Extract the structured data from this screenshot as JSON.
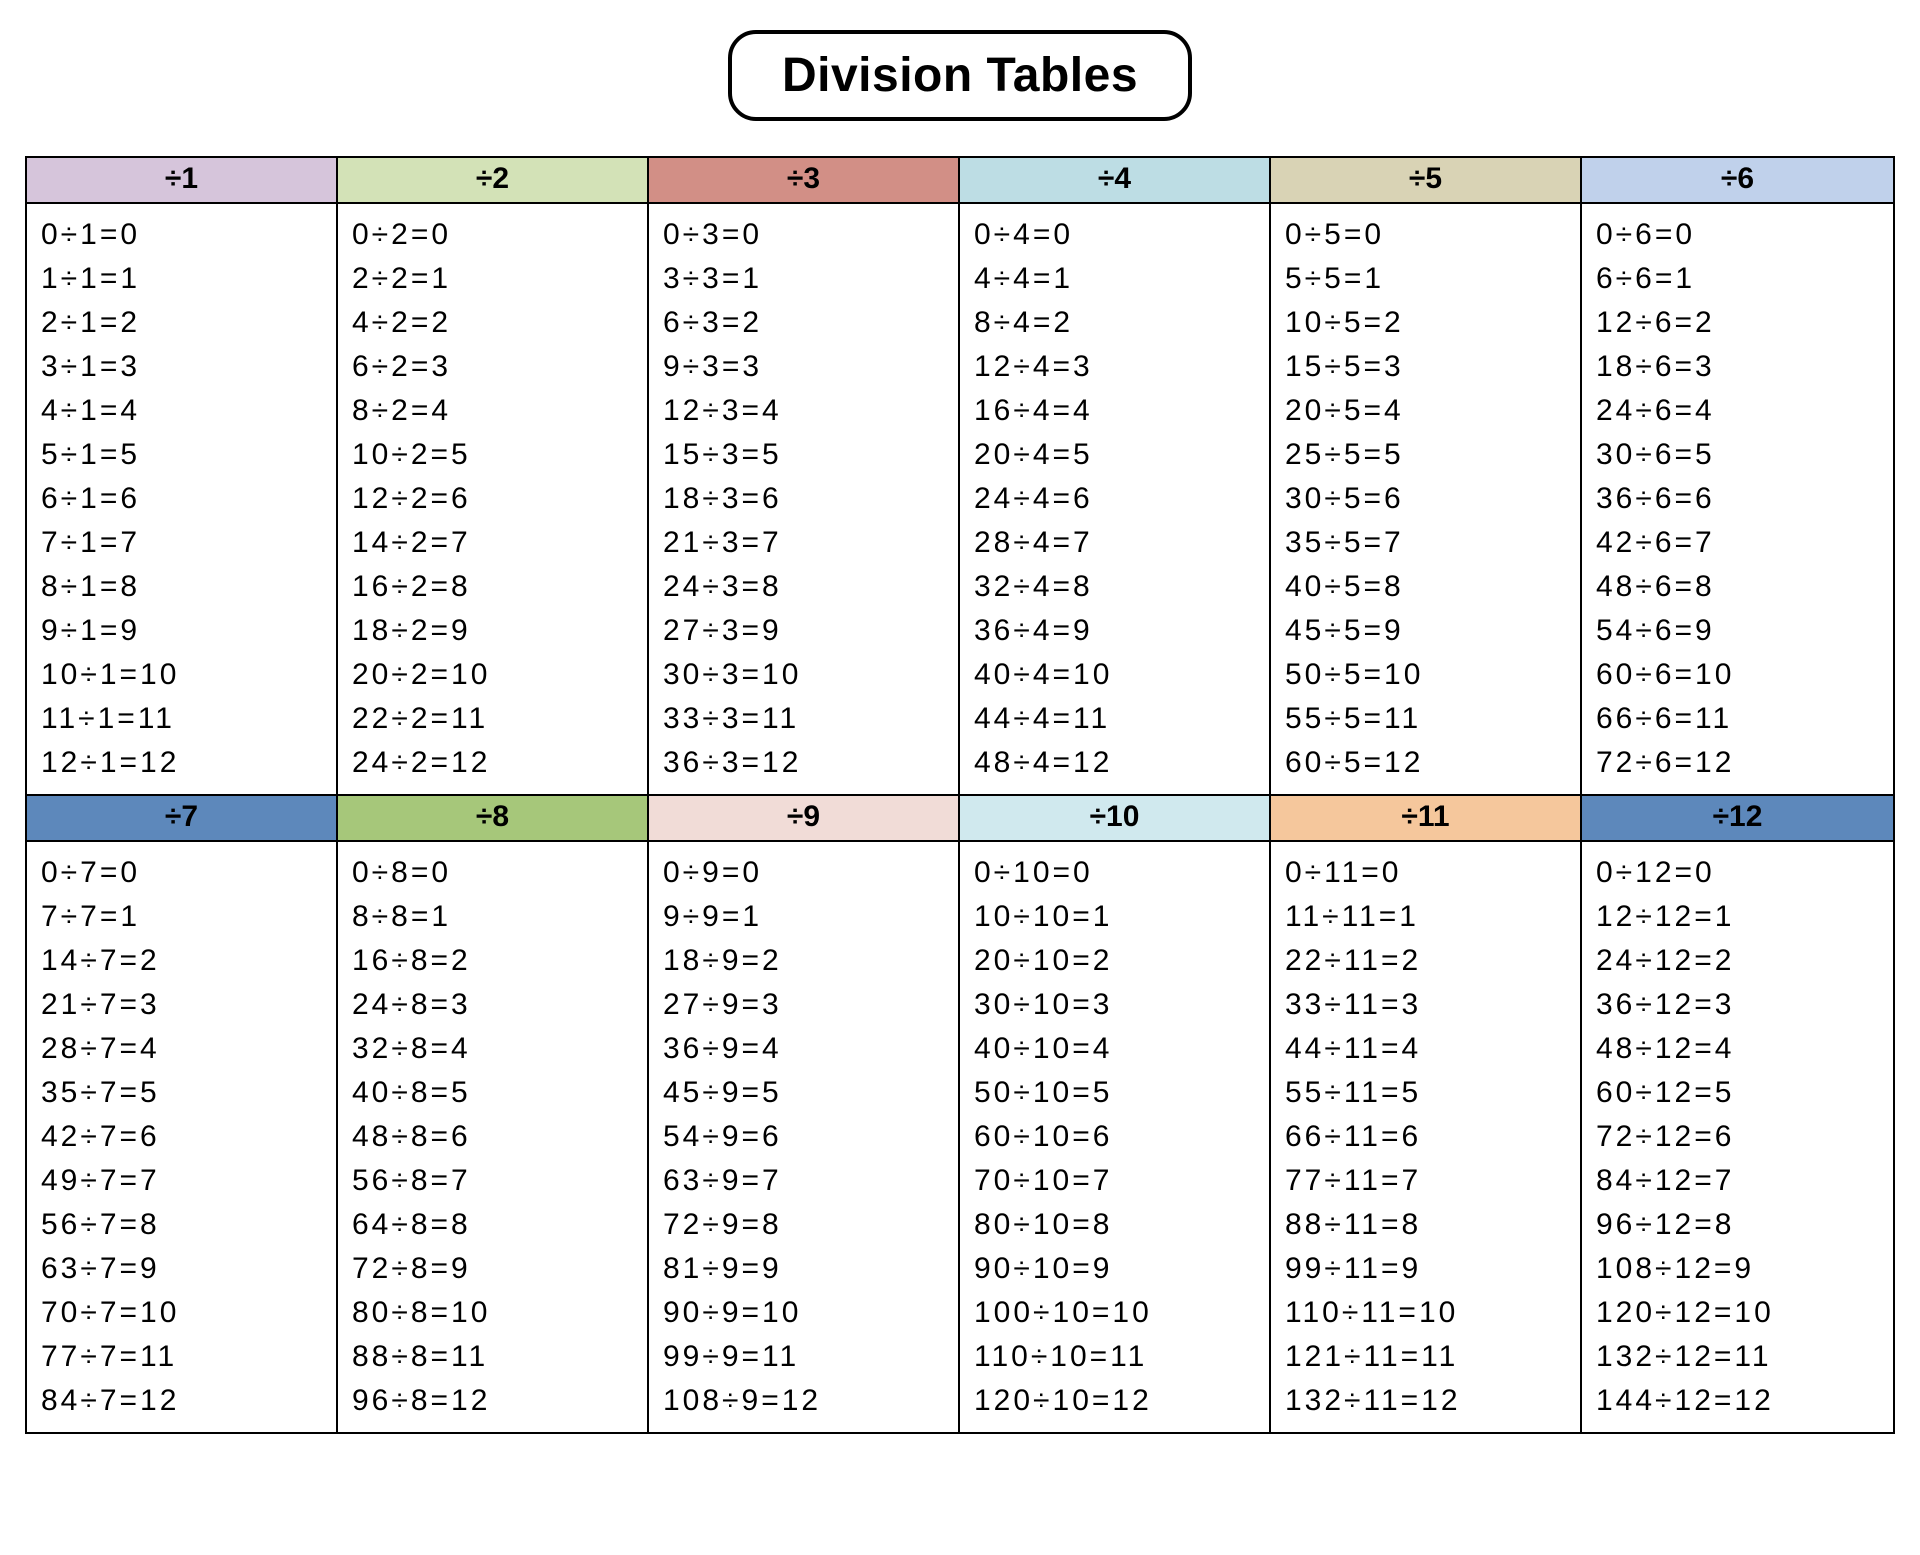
{
  "title": "Division Tables",
  "headerColors": {
    "1": "#d6c5db",
    "2": "#d3e2b7",
    "3": "#d28f86",
    "4": "#bddde4",
    "5": "#d9d3b5",
    "6": "#c0d1eb",
    "7": "#5d88bb",
    "8": "#a6c77a",
    "9": "#f1dcd7",
    "10": "#d0e9ee",
    "11": "#f5c79c",
    "12": "#5d88bb"
  },
  "chart_data": {
    "type": "table",
    "title": "Division Tables",
    "divisors": [
      1,
      2,
      3,
      4,
      5,
      6,
      7,
      8,
      9,
      10,
      11,
      12
    ],
    "quotients": [
      0,
      1,
      2,
      3,
      4,
      5,
      6,
      7,
      8,
      9,
      10,
      11,
      12
    ],
    "tables": [
      {
        "divisor": 1,
        "header": "÷1",
        "rows": [
          [
            0,
            1,
            0
          ],
          [
            1,
            1,
            1
          ],
          [
            2,
            1,
            2
          ],
          [
            3,
            1,
            3
          ],
          [
            4,
            1,
            4
          ],
          [
            5,
            1,
            5
          ],
          [
            6,
            1,
            6
          ],
          [
            7,
            1,
            7
          ],
          [
            8,
            1,
            8
          ],
          [
            9,
            1,
            9
          ],
          [
            10,
            1,
            10
          ],
          [
            11,
            1,
            11
          ],
          [
            12,
            1,
            12
          ]
        ]
      },
      {
        "divisor": 2,
        "header": "÷2",
        "rows": [
          [
            0,
            2,
            0
          ],
          [
            2,
            2,
            1
          ],
          [
            4,
            2,
            2
          ],
          [
            6,
            2,
            3
          ],
          [
            8,
            2,
            4
          ],
          [
            10,
            2,
            5
          ],
          [
            12,
            2,
            6
          ],
          [
            14,
            2,
            7
          ],
          [
            16,
            2,
            8
          ],
          [
            18,
            2,
            9
          ],
          [
            20,
            2,
            10
          ],
          [
            22,
            2,
            11
          ],
          [
            24,
            2,
            12
          ]
        ]
      },
      {
        "divisor": 3,
        "header": "÷3",
        "rows": [
          [
            0,
            3,
            0
          ],
          [
            3,
            3,
            1
          ],
          [
            6,
            3,
            2
          ],
          [
            9,
            3,
            3
          ],
          [
            12,
            3,
            4
          ],
          [
            15,
            3,
            5
          ],
          [
            18,
            3,
            6
          ],
          [
            21,
            3,
            7
          ],
          [
            24,
            3,
            8
          ],
          [
            27,
            3,
            9
          ],
          [
            30,
            3,
            10
          ],
          [
            33,
            3,
            11
          ],
          [
            36,
            3,
            12
          ]
        ]
      },
      {
        "divisor": 4,
        "header": "÷4",
        "rows": [
          [
            0,
            4,
            0
          ],
          [
            4,
            4,
            1
          ],
          [
            8,
            4,
            2
          ],
          [
            12,
            4,
            3
          ],
          [
            16,
            4,
            4
          ],
          [
            20,
            4,
            5
          ],
          [
            24,
            4,
            6
          ],
          [
            28,
            4,
            7
          ],
          [
            32,
            4,
            8
          ],
          [
            36,
            4,
            9
          ],
          [
            40,
            4,
            10
          ],
          [
            44,
            4,
            11
          ],
          [
            48,
            4,
            12
          ]
        ]
      },
      {
        "divisor": 5,
        "header": "÷5",
        "rows": [
          [
            0,
            5,
            0
          ],
          [
            5,
            5,
            1
          ],
          [
            10,
            5,
            2
          ],
          [
            15,
            5,
            3
          ],
          [
            20,
            5,
            4
          ],
          [
            25,
            5,
            5
          ],
          [
            30,
            5,
            6
          ],
          [
            35,
            5,
            7
          ],
          [
            40,
            5,
            8
          ],
          [
            45,
            5,
            9
          ],
          [
            50,
            5,
            10
          ],
          [
            55,
            5,
            11
          ],
          [
            60,
            5,
            12
          ]
        ]
      },
      {
        "divisor": 6,
        "header": "÷6",
        "rows": [
          [
            0,
            6,
            0
          ],
          [
            6,
            6,
            1
          ],
          [
            12,
            6,
            2
          ],
          [
            18,
            6,
            3
          ],
          [
            24,
            6,
            4
          ],
          [
            30,
            6,
            5
          ],
          [
            36,
            6,
            6
          ],
          [
            42,
            6,
            7
          ],
          [
            48,
            6,
            8
          ],
          [
            54,
            6,
            9
          ],
          [
            60,
            6,
            10
          ],
          [
            66,
            6,
            11
          ],
          [
            72,
            6,
            12
          ]
        ]
      },
      {
        "divisor": 7,
        "header": "÷7",
        "rows": [
          [
            0,
            7,
            0
          ],
          [
            7,
            7,
            1
          ],
          [
            14,
            7,
            2
          ],
          [
            21,
            7,
            3
          ],
          [
            28,
            7,
            4
          ],
          [
            35,
            7,
            5
          ],
          [
            42,
            7,
            6
          ],
          [
            49,
            7,
            7
          ],
          [
            56,
            7,
            8
          ],
          [
            63,
            7,
            9
          ],
          [
            70,
            7,
            10
          ],
          [
            77,
            7,
            11
          ],
          [
            84,
            7,
            12
          ]
        ]
      },
      {
        "divisor": 8,
        "header": "÷8",
        "rows": [
          [
            0,
            8,
            0
          ],
          [
            8,
            8,
            1
          ],
          [
            16,
            8,
            2
          ],
          [
            24,
            8,
            3
          ],
          [
            32,
            8,
            4
          ],
          [
            40,
            8,
            5
          ],
          [
            48,
            8,
            6
          ],
          [
            56,
            8,
            7
          ],
          [
            64,
            8,
            8
          ],
          [
            72,
            8,
            9
          ],
          [
            80,
            8,
            10
          ],
          [
            88,
            8,
            11
          ],
          [
            96,
            8,
            12
          ]
        ]
      },
      {
        "divisor": 9,
        "header": "÷9",
        "rows": [
          [
            0,
            9,
            0
          ],
          [
            9,
            9,
            1
          ],
          [
            18,
            9,
            2
          ],
          [
            27,
            9,
            3
          ],
          [
            36,
            9,
            4
          ],
          [
            45,
            9,
            5
          ],
          [
            54,
            9,
            6
          ],
          [
            63,
            9,
            7
          ],
          [
            72,
            9,
            8
          ],
          [
            81,
            9,
            9
          ],
          [
            90,
            9,
            10
          ],
          [
            99,
            9,
            11
          ],
          [
            108,
            9,
            12
          ]
        ]
      },
      {
        "divisor": 10,
        "header": "÷10",
        "rows": [
          [
            0,
            10,
            0
          ],
          [
            10,
            10,
            1
          ],
          [
            20,
            10,
            2
          ],
          [
            30,
            10,
            3
          ],
          [
            40,
            10,
            4
          ],
          [
            50,
            10,
            5
          ],
          [
            60,
            10,
            6
          ],
          [
            70,
            10,
            7
          ],
          [
            80,
            10,
            8
          ],
          [
            90,
            10,
            9
          ],
          [
            100,
            10,
            10
          ],
          [
            110,
            10,
            11
          ],
          [
            120,
            10,
            12
          ]
        ]
      },
      {
        "divisor": 11,
        "header": "÷11",
        "rows": [
          [
            0,
            11,
            0
          ],
          [
            11,
            11,
            1
          ],
          [
            22,
            11,
            2
          ],
          [
            33,
            11,
            3
          ],
          [
            44,
            11,
            4
          ],
          [
            55,
            11,
            5
          ],
          [
            66,
            11,
            6
          ],
          [
            77,
            11,
            7
          ],
          [
            88,
            11,
            8
          ],
          [
            99,
            11,
            9
          ],
          [
            110,
            11,
            10
          ],
          [
            121,
            11,
            11
          ],
          [
            132,
            11,
            12
          ]
        ]
      },
      {
        "divisor": 12,
        "header": "÷12",
        "rows": [
          [
            0,
            12,
            0
          ],
          [
            12,
            12,
            1
          ],
          [
            24,
            12,
            2
          ],
          [
            36,
            12,
            3
          ],
          [
            48,
            12,
            4
          ],
          [
            60,
            12,
            5
          ],
          [
            72,
            12,
            6
          ],
          [
            84,
            12,
            7
          ],
          [
            96,
            12,
            8
          ],
          [
            108,
            12,
            9
          ],
          [
            120,
            12,
            10
          ],
          [
            132,
            12,
            11
          ],
          [
            144,
            12,
            12
          ]
        ]
      }
    ]
  }
}
